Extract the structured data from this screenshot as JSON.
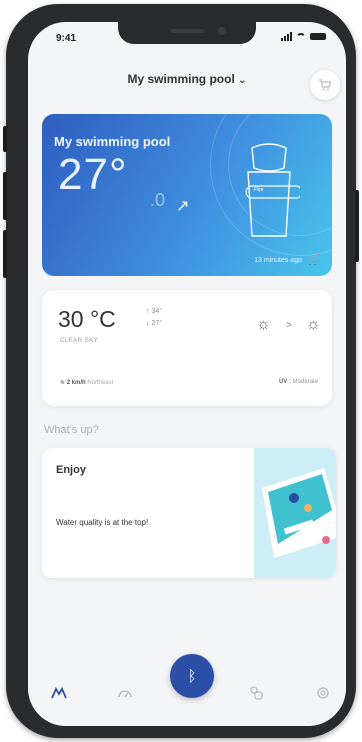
{
  "status": {
    "time": "9:41"
  },
  "header": {
    "title": "My swimming pool",
    "chevron": "⌄"
  },
  "pool_card": {
    "title": "My swimming pool",
    "temperature": "27°",
    "temperature_decimal": ".0",
    "updated": "13 minutes ago",
    "device_label": "Flipr"
  },
  "weather": {
    "temperature": "30 °C",
    "high": "↑ 34°",
    "low": "↓ 27°",
    "condition": "CLEAR SKY",
    "wind_speed": "2 km/h",
    "wind_direction": "Northeast",
    "uv_label": "UV :",
    "uv_value": "Moderate"
  },
  "section": {
    "whats_up": "What's up?"
  },
  "news": {
    "title": "Enjoy",
    "text": "Water quality is at the top!"
  },
  "tabbar": {
    "items": [
      "home-tab-icon",
      "gauge-tab-icon",
      "bluetooth-icon",
      "shop-tab-icon",
      "settings-tab-icon"
    ],
    "active": "home-tab-icon"
  },
  "colors": {
    "accent": "#2b4ea6",
    "card_gradient_start": "#2f5dbf",
    "card_gradient_end": "#48c5ea"
  }
}
